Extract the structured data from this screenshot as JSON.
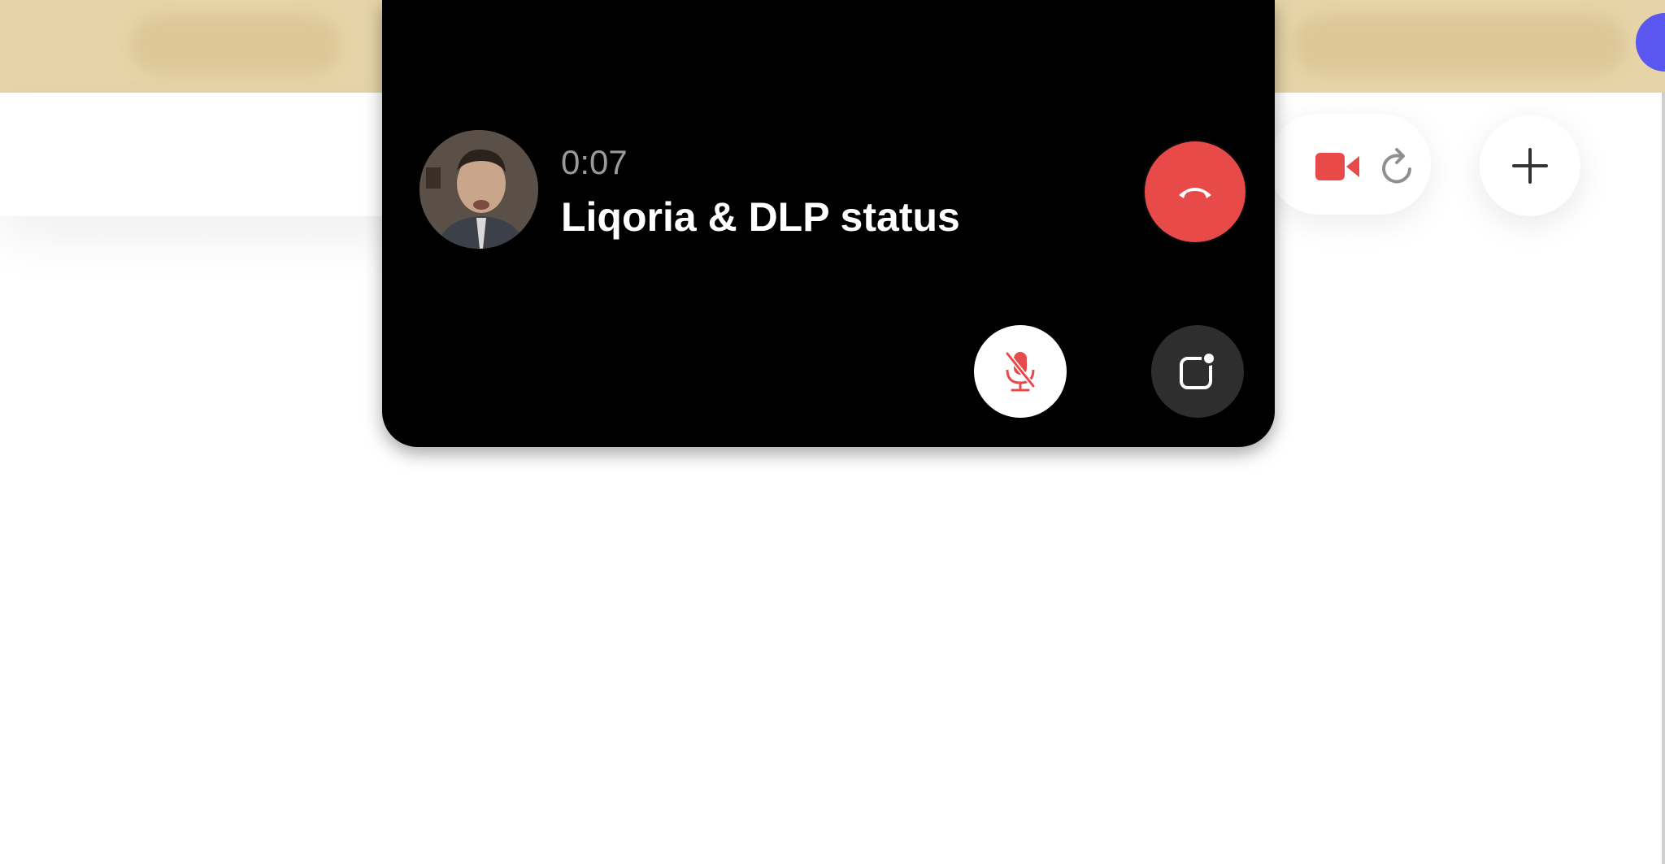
{
  "call": {
    "duration": "0:07",
    "title": "Liqoria & DLP status",
    "avatar_icon": "person-avatar",
    "end_call_icon": "phone-hangup-icon",
    "mute_icon": "microphone-off-icon",
    "screen_share_icon": "screen-share-icon"
  },
  "toolbar": {
    "video_icon": "video-camera-icon",
    "refresh_icon": "refresh-icon",
    "add_icon": "plus-icon"
  },
  "colors": {
    "topbar": "#e6d4a8",
    "panel": "#000000",
    "end_call": "#e84a4a",
    "accent_dot": "#5a56f0",
    "video_icon": "#e84a4a"
  }
}
